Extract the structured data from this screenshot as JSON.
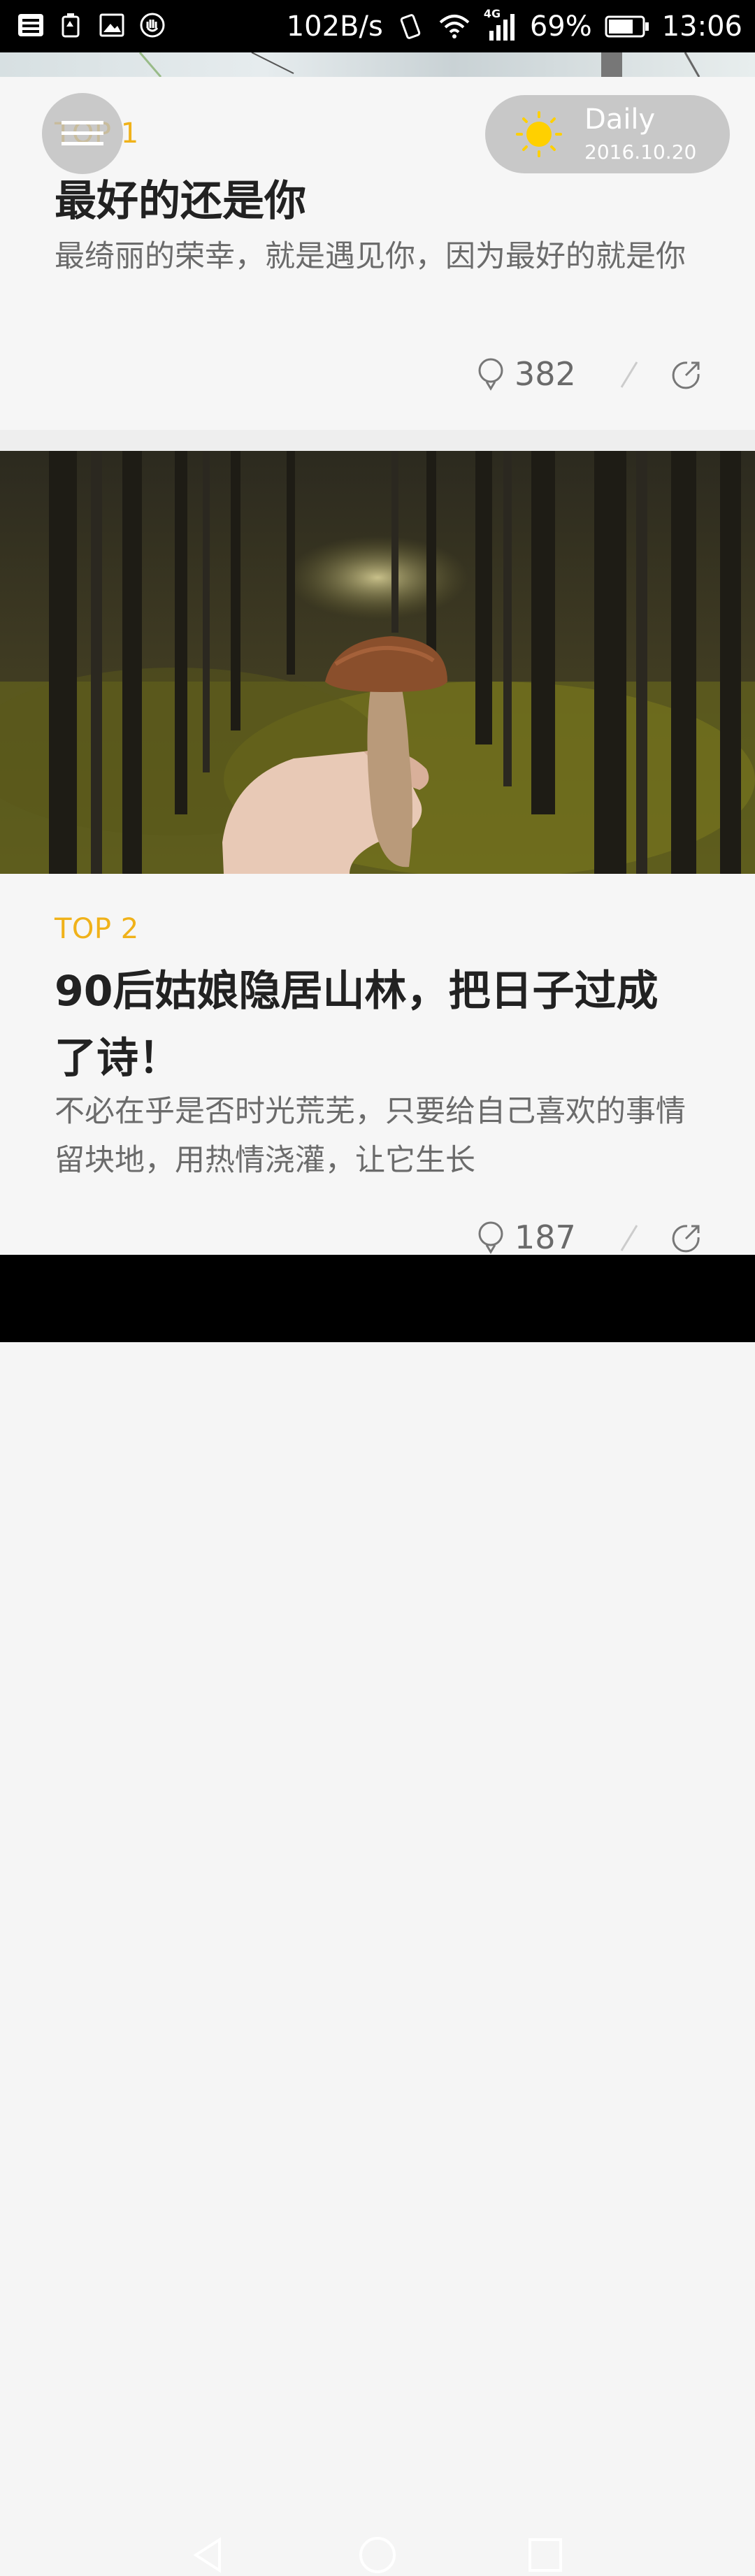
{
  "status_bar": {
    "left_icons": [
      "toutiao-icon",
      "battery-saver-icon",
      "image-icon",
      "hand-icon"
    ],
    "net_speed": "102B/s",
    "network_type": "4G",
    "battery": "69%",
    "time": "13:06"
  },
  "header": {
    "daily_label": "Daily",
    "date": "2016.10.20"
  },
  "articles": [
    {
      "rank": "TOP 1",
      "title": "最好的还是你",
      "summary": "最绮丽的荣幸，就是遇见你，因为最好的就是你",
      "likes": "382"
    },
    {
      "rank": "TOP 2",
      "title": "90后姑娘隐居山林，把日子过成了诗！",
      "summary": "不必在乎是否时光荒芜，只要给自己喜欢的事情留块地，用热情浇灌，让它生长",
      "likes": "187"
    }
  ],
  "colors": {
    "accent": "#f0b21a",
    "title": "#222222",
    "summary": "#6b6b6b",
    "background": "#f6f6f6"
  }
}
